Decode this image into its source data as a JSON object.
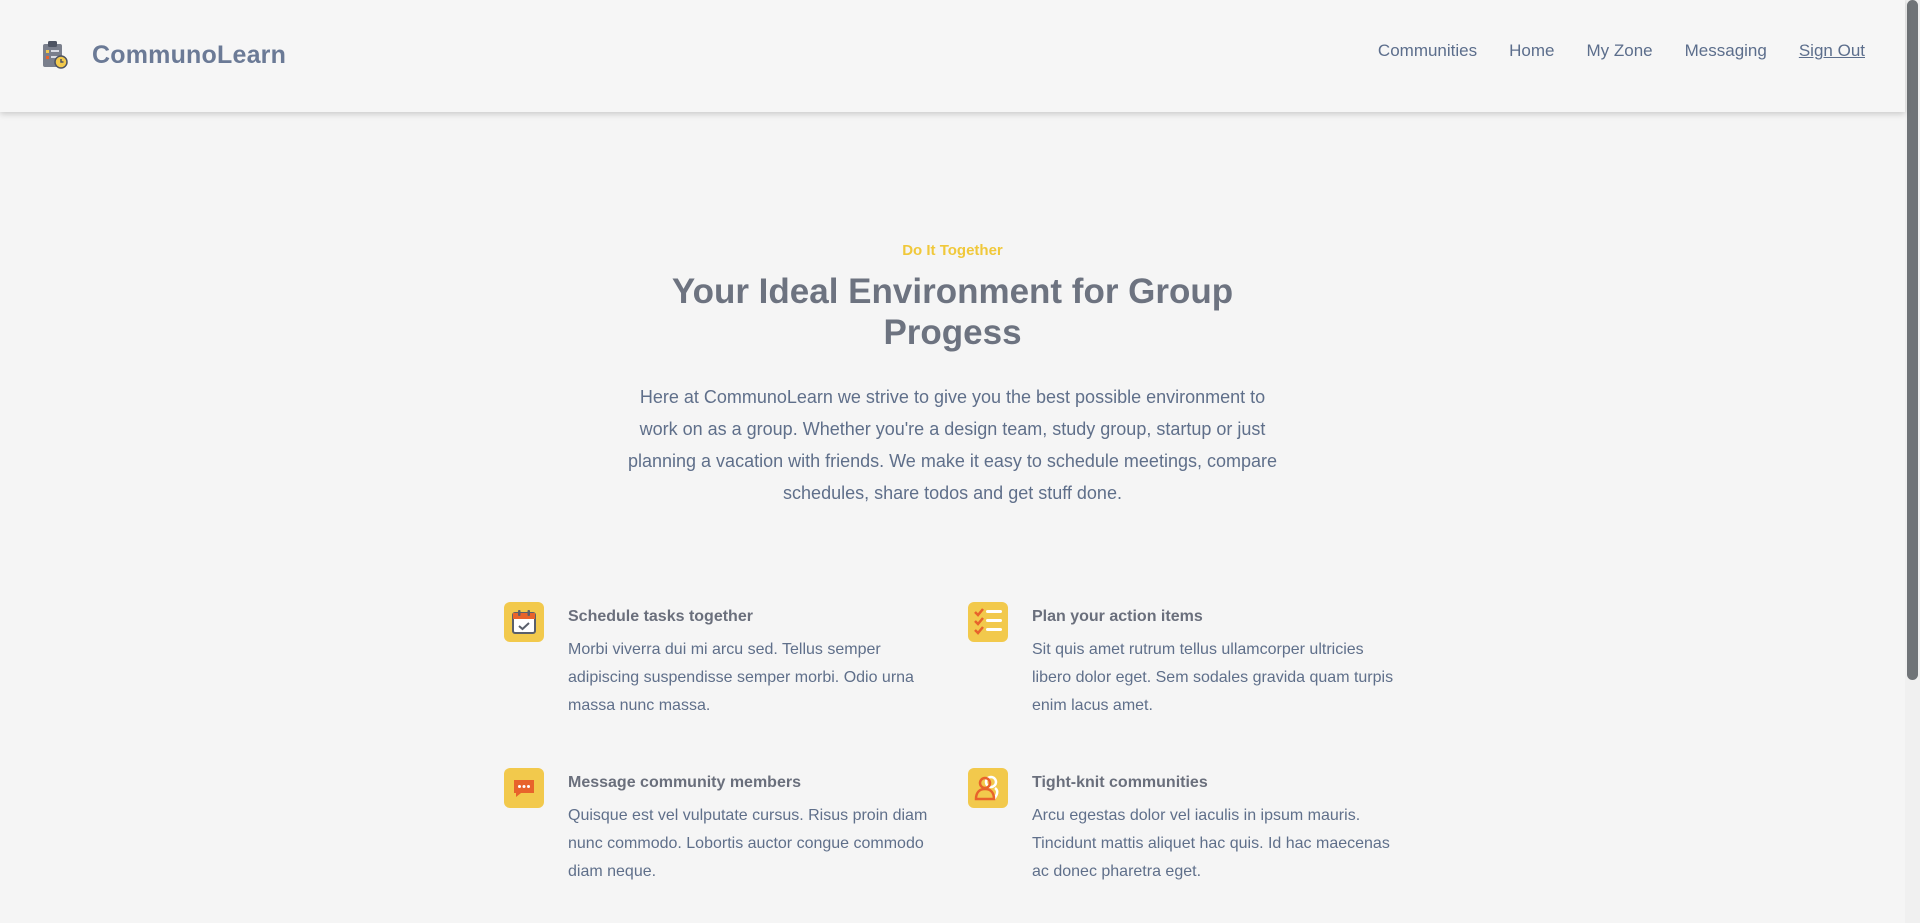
{
  "brand": {
    "name": "CommunoLearn",
    "logo_icon": "clipboard-clock-icon"
  },
  "nav": {
    "items": [
      {
        "label": "Communities"
      },
      {
        "label": "Home"
      },
      {
        "label": "My Zone"
      },
      {
        "label": "Messaging"
      },
      {
        "label": "Sign Out"
      }
    ]
  },
  "hero": {
    "eyebrow": "Do It Together",
    "title": "Your Ideal Environment for Group Progess",
    "text": "Here at CommunoLearn we strive to give you the best possible environment to work on as a group. Whether you're a design team, study group, startup or just planning a vacation with friends. We make it easy to schedule meetings, compare schedules, share todos and get stuff done."
  },
  "features": [
    {
      "icon": "calendar-check-icon",
      "title": "Schedule tasks together",
      "desc": "Morbi viverra dui mi arcu sed. Tellus semper adipiscing suspendisse semper morbi. Odio urna massa nunc massa."
    },
    {
      "icon": "checklist-icon",
      "title": "Plan your action items",
      "desc": "Sit quis amet rutrum tellus ullamcorper ultricies libero dolor eget. Sem sodales gravida quam turpis enim lacus amet."
    },
    {
      "icon": "chat-bubble-icon",
      "title": "Message community members",
      "desc": "Quisque est vel vulputate cursus. Risus proin diam nunc commodo. Lobortis auctor congue commodo diam neque."
    },
    {
      "icon": "users-icon",
      "title": "Tight-knit communities",
      "desc": "Arcu egestas dolor vel iaculis in ipsum mauris. Tincidunt mattis aliquet hac quis. Id hac maecenas ac donec pharetra eget."
    }
  ],
  "colors": {
    "accent": "#f2c94c",
    "eyebrow": "#f0c83a",
    "icon_orange": "#e8632b",
    "text": "#5f6f8a",
    "heading": "#6d7380",
    "background": "#f5f5f5"
  }
}
